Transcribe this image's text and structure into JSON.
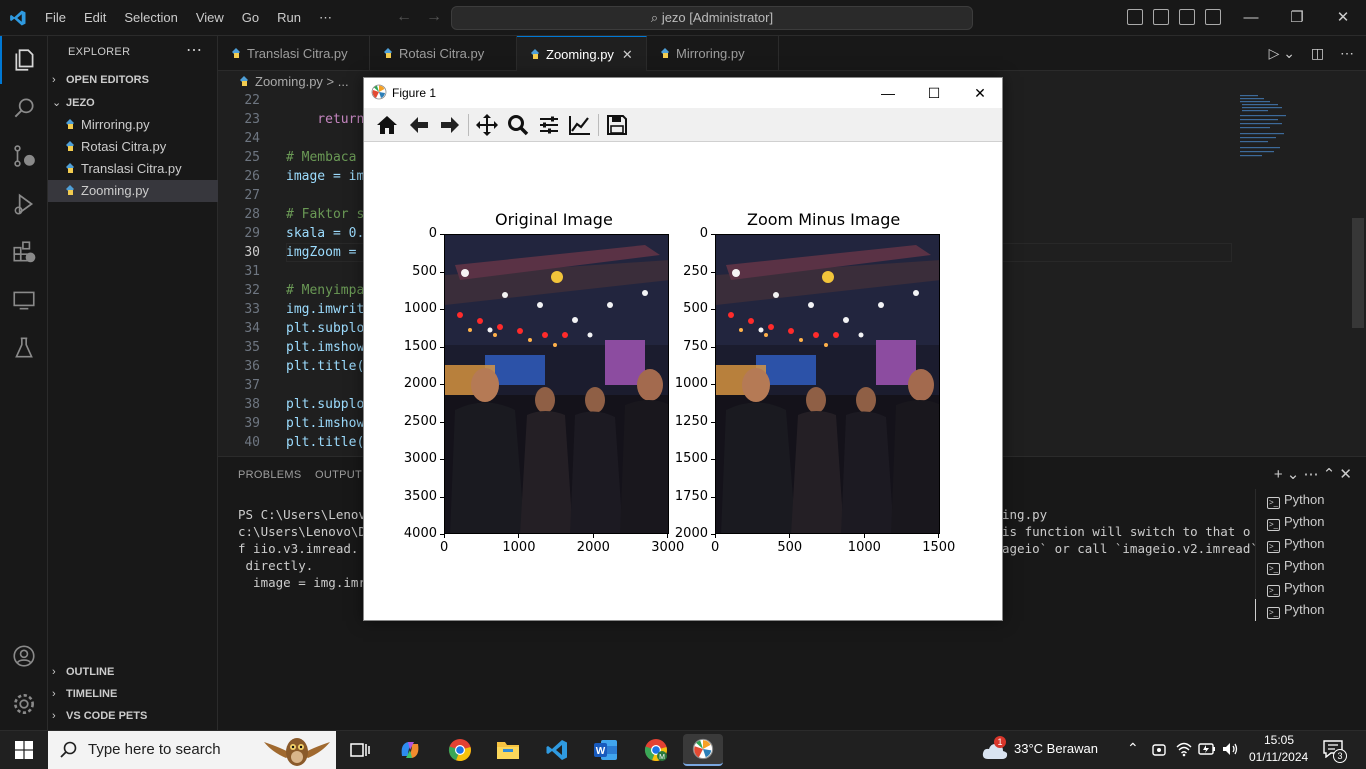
{
  "menu": [
    "File",
    "Edit",
    "Selection",
    "View",
    "Go",
    "Run",
    "⋯"
  ],
  "command_center": "⌕ jezo [Administrator]",
  "window_controls": {
    "minimize": "—",
    "restore": "❐",
    "close": "✕"
  },
  "sidebar": {
    "title": "EXPLORER",
    "dots": "⋯",
    "open_editors": "OPEN EDITORS",
    "folder": "JEZO",
    "files": [
      "Mirroring.py",
      "Rotasi Citra.py",
      "Translasi Citra.py",
      "Zooming.py"
    ],
    "outline": "OUTLINE",
    "timeline": "TIMELINE",
    "pets": "VS CODE PETS"
  },
  "tabs": [
    {
      "label": "Translasi Citra.py"
    },
    {
      "label": "Rotasi Citra.py"
    },
    {
      "label": "Zooming.py",
      "close": "✕"
    },
    {
      "label": "Mirroring.py"
    }
  ],
  "breadcrumb": "Zooming.py > ...",
  "editor": {
    "line_numbers": [
      "22",
      "23",
      "24",
      "25",
      "26",
      "27",
      "28",
      "29",
      "30",
      "31",
      "32",
      "33",
      "34",
      "35",
      "36",
      "37",
      "38",
      "39",
      "40"
    ],
    "current_line": "30",
    "lines": [
      "",
      "    return",
      "",
      "# Membaca",
      "image = im",
      "",
      "# Faktor s",
      "skala = 0.",
      "imgZoom = ",
      "",
      "# Menyimpa",
      "img.imwrit",
      "plt.subplo",
      "plt.imshow",
      "plt.title(",
      "",
      "plt.subplo",
      "plt.imshow",
      "plt.title("
    ]
  },
  "panel": {
    "tabs": [
      "PROBLEMS",
      "OUTPUT"
    ],
    "terminal_left": [
      "PS C:\\Users\\Lenovo",
      "c:\\Users\\Lenovo\\Do",
      "f iio.v3.imread. T",
      " directly.",
      "  image = img.imre"
    ],
    "terminal_right": [
      "ing.py",
      "is function will switch to that o",
      "ageio` or call `imageio.v2.imread`"
    ],
    "terminals": [
      "Python",
      "Python",
      "Python",
      "Python",
      "Python",
      "Python"
    ],
    "actions": "+ ⌄  ⋯  ⌃  ✕"
  },
  "figure": {
    "title": "Figure 1",
    "controls": {
      "minimize": "—",
      "maximize": "☐",
      "close": "✕"
    },
    "plots": [
      {
        "title": "Original Image",
        "yticks": [
          "0",
          "500",
          "1000",
          "1500",
          "2000",
          "2500",
          "3000",
          "3500",
          "4000"
        ],
        "xticks": [
          "0",
          "1000",
          "2000",
          "3000"
        ]
      },
      {
        "title": "Zoom Minus Image",
        "yticks": [
          "0",
          "250",
          "500",
          "750",
          "1000",
          "1250",
          "1500",
          "1750",
          "2000"
        ],
        "xticks": [
          "0",
          "500",
          "1000",
          "1500"
        ]
      }
    ]
  },
  "taskbar": {
    "search_placeholder": "Type here to search",
    "weather": "33°C  Berawan",
    "weather_badge": "1",
    "time": "15:05",
    "date": "01/11/2024",
    "notifications": "3"
  }
}
